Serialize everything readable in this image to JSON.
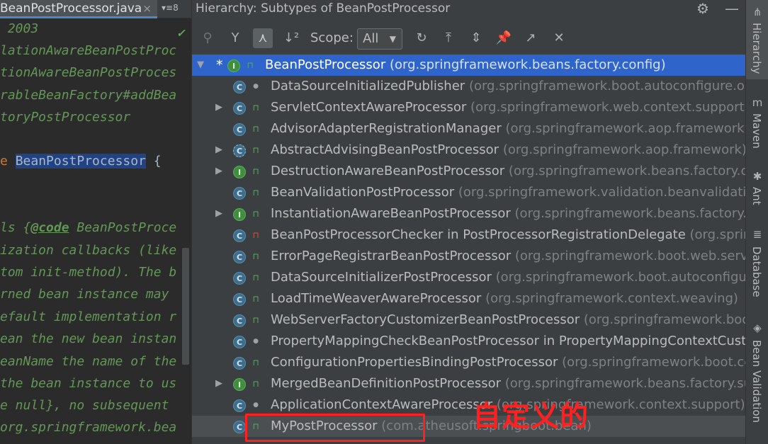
{
  "editor": {
    "tab_title": "BeanPostProcessor.java",
    "tab_close": "×",
    "tab_overflow": "▾≡8",
    "lines": [
      {
        "segments": [
          {
            "t": " 2003",
            "c": "doc"
          }
        ],
        "check": true
      },
      {
        "segments": [
          {
            "t": "lationAwareBeanPostProc",
            "c": "doc"
          }
        ]
      },
      {
        "segments": [
          {
            "t": "tionAwareBeanPostProces",
            "c": "doc"
          }
        ]
      },
      {
        "segments": [
          {
            "t": "rableBeanFactory#addBea",
            "c": "doc"
          }
        ]
      },
      {
        "segments": [
          {
            "t": "toryPostProcessor",
            "c": "doc"
          }
        ]
      },
      {
        "segments": []
      },
      {
        "segments": [
          {
            "t": "e ",
            "c": "kw"
          },
          {
            "t": "BeanPostProcessor",
            "c": "hl"
          },
          {
            "t": " {",
            "c": "code"
          }
        ]
      },
      {
        "segments": []
      },
      {
        "segments": []
      },
      {
        "segments": [
          {
            "t": "ls {",
            "c": "doc"
          },
          {
            "t": "@code",
            "c": "tag"
          },
          {
            "t": " BeanPostProce",
            "c": "doc"
          }
        ]
      },
      {
        "segments": [
          {
            "t": "ization callbacks (like",
            "c": "doc"
          }
        ]
      },
      {
        "segments": [
          {
            "t": "tom init-method). The b",
            "c": "doc"
          }
        ]
      },
      {
        "segments": [
          {
            "t": "rned bean instance may",
            "c": "doc"
          }
        ]
      },
      {
        "segments": [
          {
            "t": "efault implementation r",
            "c": "doc"
          }
        ]
      },
      {
        "segments": [
          {
            "t": "ean the new bean instan",
            "c": "doc"
          }
        ]
      },
      {
        "segments": [
          {
            "t": "eanName the name of the",
            "c": "doc"
          }
        ]
      },
      {
        "segments": [
          {
            "t": "the bean instance to us",
            "c": "doc"
          }
        ]
      },
      {
        "segments": [
          {
            "t": "e null}, no subsequent",
            "c": "doc"
          }
        ]
      },
      {
        "segments": [
          {
            "t": "org.springframework.bea",
            "c": "doc"
          }
        ]
      }
    ]
  },
  "panel": {
    "header_label": "Hierarchy:",
    "header_title": "Subtypes of BeanPostProcessor",
    "gear_icon": "settings-gear",
    "minimize_icon": "minimize",
    "toolbar": {
      "scope_label": "Scope:",
      "scope_value": "All",
      "buttons": [
        {
          "name": "supertypes-hierarchy-icon",
          "glyph": "⚲",
          "state": "disabled"
        },
        {
          "name": "type-hierarchy-icon",
          "glyph": "Y",
          "state": "normal"
        },
        {
          "name": "subtypes-hierarchy-icon",
          "glyph": "⋏",
          "state": "active"
        },
        {
          "name": "sort-alphabetically-icon",
          "glyph": "↓²",
          "state": "normal"
        },
        {
          "name": "refresh-icon",
          "glyph": "↻",
          "state": "normal"
        },
        {
          "name": "export-icon",
          "glyph": "⤒",
          "state": "normal"
        },
        {
          "name": "expand-all-icon",
          "glyph": "⇕",
          "state": "normal"
        },
        {
          "name": "pin-icon",
          "glyph": "📌",
          "state": "normal"
        },
        {
          "name": "open-in-window-icon",
          "glyph": "↗",
          "state": "normal"
        },
        {
          "name": "close-icon",
          "glyph": "✕",
          "state": "normal"
        }
      ]
    },
    "tree": [
      {
        "level": 0,
        "expand": "open",
        "star": true,
        "kind": "interface",
        "vis": "public",
        "name": "BeanPostProcessor",
        "pkg": "(org.springframework.beans.factory.config)",
        "selected": true
      },
      {
        "level": 1,
        "expand": "",
        "kind": "class",
        "vis": "package",
        "name": "DataSourceInitializedPublisher",
        "pkg": "(org.springframework.boot.autoconfigure.orm.jpa)"
      },
      {
        "level": 1,
        "expand": "closed",
        "kind": "class",
        "vis": "public",
        "name": "ServletContextAwareProcessor",
        "pkg": "(org.springframework.web.context.support)"
      },
      {
        "level": 1,
        "expand": "",
        "kind": "class",
        "vis": "public",
        "name": "AdvisorAdapterRegistrationManager",
        "pkg": "(org.springframework.aop.framework.adapter)"
      },
      {
        "level": 1,
        "expand": "closed",
        "kind": "abstract",
        "vis": "public",
        "name": "AbstractAdvisingBeanPostProcessor",
        "pkg": "(org.springframework.aop.framework)"
      },
      {
        "level": 1,
        "expand": "closed",
        "kind": "interface",
        "vis": "public",
        "name": "DestructionAwareBeanPostProcessor",
        "pkg": "(org.springframework.beans.factory.config)"
      },
      {
        "level": 1,
        "expand": "",
        "kind": "class",
        "vis": "public",
        "name": "BeanValidationPostProcessor",
        "pkg": "(org.springframework.validation.beanvalidation)"
      },
      {
        "level": 1,
        "expand": "closed",
        "kind": "interface",
        "vis": "public",
        "name": "InstantiationAwareBeanPostProcessor",
        "pkg": "(org.springframework.beans.factory.config)"
      },
      {
        "level": 1,
        "expand": "",
        "kind": "class",
        "vis": "private",
        "name": "BeanPostProcessorChecker in PostProcessorRegistrationDelegate",
        "pkg": "(org.springframework.context.support)"
      },
      {
        "level": 1,
        "expand": "",
        "kind": "class",
        "vis": "public",
        "name": "ErrorPageRegistrarBeanPostProcessor",
        "pkg": "(org.springframework.boot.web.server)"
      },
      {
        "level": 1,
        "expand": "",
        "kind": "class",
        "vis": "public",
        "name": "DataSourceInitializerPostProcessor",
        "pkg": "(org.springframework.boot.autoconfigure.jdbc)"
      },
      {
        "level": 1,
        "expand": "",
        "kind": "class",
        "vis": "public",
        "name": "LoadTimeWeaverAwareProcessor",
        "pkg": "(org.springframework.context.weaving)"
      },
      {
        "level": 1,
        "expand": "",
        "kind": "class",
        "vis": "public",
        "name": "WebServerFactoryCustomizerBeanPostProcessor",
        "pkg": "(org.springframework.boot.web.server)"
      },
      {
        "level": 1,
        "expand": "",
        "kind": "class",
        "vis": "package",
        "name": "PropertyMappingCheckBeanPostProcessor in PropertyMappingContextCustomizer",
        "pkg": ""
      },
      {
        "level": 1,
        "expand": "",
        "kind": "class",
        "vis": "public",
        "name": "ConfigurationPropertiesBindingPostProcessor",
        "pkg": "(org.springframework.boot.context.properties)"
      },
      {
        "level": 1,
        "expand": "closed",
        "kind": "interface",
        "vis": "public",
        "name": "MergedBeanDefinitionPostProcessor",
        "pkg": "(org.springframework.beans.factory.support)"
      },
      {
        "level": 1,
        "expand": "",
        "kind": "class",
        "vis": "package",
        "name": "ApplicationContextAwareProcessor",
        "pkg": "(org.springframework.context.support)"
      },
      {
        "level": 1,
        "expand": "",
        "kind": "class",
        "vis": "public",
        "name": "MyPostProcessor",
        "pkg": "(com.atheusoft.springboot.bean)",
        "highlight": true
      }
    ],
    "annotation_text": "自定义的"
  },
  "right_strip": [
    {
      "label": "Hierarchy",
      "icon": "hierarchy-icon",
      "glyph": "⋔",
      "active": true
    },
    {
      "label": "Maven",
      "icon": "maven-icon",
      "glyph": "m",
      "active": false
    },
    {
      "label": "Ant",
      "icon": "ant-icon",
      "glyph": "✱",
      "active": false
    },
    {
      "label": "Database",
      "icon": "database-icon",
      "glyph": "≣",
      "active": false
    },
    {
      "label": "Bean Validation",
      "icon": "bean-validation-icon",
      "glyph": "◈",
      "active": false
    }
  ]
}
